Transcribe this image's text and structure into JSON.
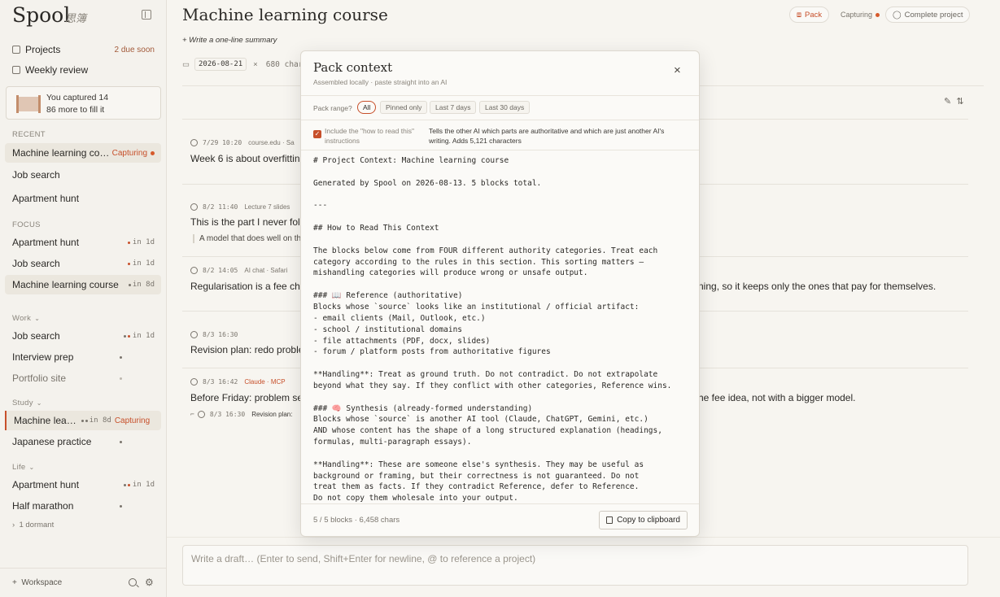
{
  "sidebar": {
    "brand": "Spool",
    "brand_sub": "思簿",
    "nav": [
      {
        "label": "Projects",
        "aux": "2 due soon"
      },
      {
        "label": "Weekly review",
        "aux": ""
      }
    ],
    "capture_card": {
      "line1": "You captured 14",
      "line2": "86 more to fill it"
    },
    "recent_label": "RECENT",
    "recent": [
      {
        "name": "Machine learning cour…",
        "tag": "Capturing"
      },
      {
        "name": "Job search"
      },
      {
        "name": "Apartment hunt"
      }
    ],
    "focus_label": "FOCUS",
    "focus": [
      {
        "name": "Apartment hunt",
        "due": "in 1d"
      },
      {
        "name": "Job search",
        "due": "in 1d"
      },
      {
        "name": "Machine learning course",
        "due": "in 8d"
      }
    ],
    "groups": [
      {
        "label": "Work",
        "items": [
          {
            "name": "Job search",
            "due": "in 1d"
          },
          {
            "name": "Interview prep"
          },
          {
            "name": "Portfolio site"
          }
        ]
      },
      {
        "label": "Study",
        "items": [
          {
            "name": "Machine lea…",
            "due": "in 8d",
            "cap": "Capturing"
          },
          {
            "name": "Japanese practice"
          }
        ]
      },
      {
        "label": "Life",
        "items": [
          {
            "name": "Apartment hunt",
            "due": "in 1d"
          },
          {
            "name": "Half marathon"
          }
        ]
      }
    ],
    "dormant": "1 dormant",
    "footer": {
      "workspace": "Workspace"
    }
  },
  "main": {
    "title": "Machine learning course",
    "summary": "+ Write a one-line summary",
    "pack_label": "Pack",
    "capturing_label": "Capturing",
    "complete_label": "Complete project",
    "date": "2026-08-21",
    "chars_text": "680 chars",
    "entries": [
      {
        "meta": "7/29 10:20",
        "source": "course.edu · Sa",
        "text": "Week 6 is about overfitting"
      },
      {
        "meta": "8/2 11:40",
        "source": "Lecture 7 slides",
        "text": "This is the part I never fol",
        "quote": "A model that does well on th"
      },
      {
        "meta": "8/2 14:05",
        "source": "AI chat · Safari",
        "text": "Regularisation is a fee cha",
        "tail": "ning, so it keeps only the ones that pay for themselves."
      },
      {
        "meta": "8/3 16:30",
        "source": "",
        "text": "Revision plan: redo proble"
      },
      {
        "meta": "8/3 16:42",
        "source": "Claude · MCP",
        "text": "Before Friday: problem se",
        "tail": "he fee idea, not with a bigger model.",
        "sub_meta": "8/3 16:30",
        "sub_text": "Revision plan:"
      }
    ],
    "draft_placeholder": "Write a draft… (Enter to send, Shift+Enter for newline, @ to reference a project)"
  },
  "modal": {
    "title": "Pack context",
    "subtitle": "Assembled locally · paste straight into an AI",
    "range_label": "Pack range?",
    "ranges": [
      "All",
      "Pinned only",
      "Last 7 days",
      "Last 30 days"
    ],
    "include_label": "Include the \"how to read this\" instructions",
    "include_desc": "Tells the other AI which parts are authoritative and which are just another AI's writing. Adds 5,121 characters",
    "content_lines": [
      "# Project Context: Machine learning course",
      "",
      "Generated by Spool on 2026-08-13. 5 blocks total.",
      "",
      "---",
      "",
      "## How to Read This Context",
      "",
      "The blocks below come from FOUR different authority categories. Treat each",
      "category according to the rules in this section. This sorting matters —",
      "mishandling categories will produce wrong or unsafe output.",
      "",
      "### 📖 Reference (authoritative)",
      "Blocks whose `source` looks like an institutional / official artifact:",
      "- email clients (Mail, Outlook, etc.)",
      "- school / institutional domains",
      "- file attachments (PDF, docx, slides)",
      "- forum / platform posts from authoritative figures",
      "",
      "**Handling**: Treat as ground truth. Do not contradict. Do not extrapolate",
      "beyond what they say. If they conflict with other categories, Reference wins.",
      "",
      "### 🧠 Synthesis (already-formed understanding)",
      "Blocks whose `source` is another AI tool (Claude, ChatGPT, Gemini, etc.)",
      "AND whose content has the shape of a long structured explanation (headings,",
      "formulas, multi-paragraph essays).",
      "",
      "**Handling**: These are someone else's synthesis. They may be useful as",
      "background or framing, but their correctness is not guaranteed. Do not",
      "treat them as facts. If they contradict Reference, defer to Reference.",
      "Do not copy them wholesale into your output."
    ],
    "footer_stats": "5 / 5 blocks · 6,458 chars",
    "copy_label": "Copy to clipboard"
  }
}
